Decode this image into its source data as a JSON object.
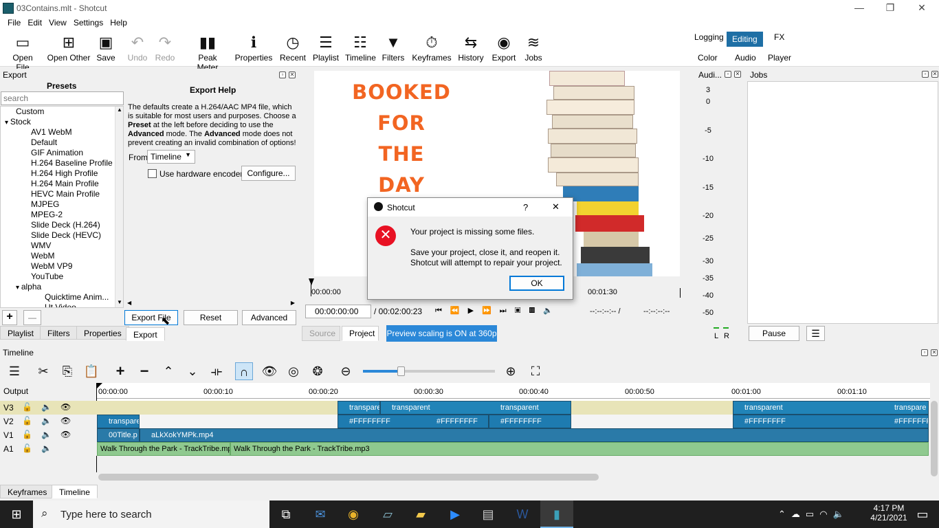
{
  "window": {
    "title": "03Contains.mlt - Shotcut",
    "minimize": "—",
    "restore": "❐",
    "close": "✕"
  },
  "menu": [
    "File",
    "Edit",
    "View",
    "Settings",
    "Help"
  ],
  "toolbar": {
    "open_file": "Open File",
    "open_other": "Open Other",
    "save": "Save",
    "undo": "Undo",
    "redo": "Redo",
    "peak_meter": "Peak Meter",
    "properties": "Properties",
    "recent": "Recent",
    "playlist": "Playlist",
    "timeline": "Timeline",
    "filters": "Filters",
    "keyframes": "Keyframes",
    "history": "History",
    "export": "Export",
    "jobs": "Jobs"
  },
  "workspaces": {
    "logging": "Logging",
    "editing": "Editing",
    "fx": "FX",
    "color": "Color",
    "audio": "Audio",
    "player": "Player"
  },
  "export_panel": {
    "title": "Export",
    "presets_title": "Presets",
    "search_placeholder": "search",
    "presets": [
      {
        "label": "Custom",
        "level": 1
      },
      {
        "label": "Stock",
        "level": 0,
        "expanded": true
      },
      {
        "label": "AV1 WebM",
        "level": 2
      },
      {
        "label": "Default",
        "level": 2
      },
      {
        "label": "GIF Animation",
        "level": 2
      },
      {
        "label": "H.264 Baseline Profile",
        "level": 2
      },
      {
        "label": "H.264 High Profile",
        "level": 2
      },
      {
        "label": "H.264 Main Profile",
        "level": 2
      },
      {
        "label": "HEVC Main Profile",
        "level": 2
      },
      {
        "label": "MJPEG",
        "level": 2
      },
      {
        "label": "MPEG-2",
        "level": 2
      },
      {
        "label": "Slide Deck (H.264)",
        "level": 2
      },
      {
        "label": "Slide Deck (HEVC)",
        "level": 2
      },
      {
        "label": "WMV",
        "level": 2
      },
      {
        "label": "WebM",
        "level": 2
      },
      {
        "label": "WebM VP9",
        "level": 2
      },
      {
        "label": "YouTube",
        "level": 2
      },
      {
        "label": "alpha",
        "level": 1,
        "expanded": true
      },
      {
        "label": "Quicktime Anim...",
        "level": 3
      },
      {
        "label": "Ut Video",
        "level": 3
      }
    ],
    "help_title": "Export Help",
    "help_p1": "The defaults create a H.264/AAC MP4 file, which is suitable for most users and purposes. Choose a ",
    "help_b1": "Preset",
    "help_p2": " at the left before deciding to use the ",
    "help_b2": "Advanced",
    "help_p3": " mode. The ",
    "help_b3": "Advanced",
    "help_p4": " mode does not prevent creating an invalid combination of options!",
    "from_label": "From",
    "from_value": "Timeline",
    "hw_encoder": "Use hardware encoder",
    "configure": "Configure...",
    "export_file": "Export File",
    "reset": "Reset",
    "advanced": "Advanced",
    "add": "+",
    "remove": "—"
  },
  "left_tabs": [
    "Playlist",
    "Filters",
    "Properties",
    "Export"
  ],
  "player": {
    "video_text": [
      "BOOKED",
      "FOR",
      "THE",
      "DAY"
    ],
    "ruler_start": "00:00:00",
    "ruler_mid": "00:01:30",
    "position": "00:00:00:00",
    "duration": "/ 00:02:00:23",
    "in_point": "--:--:--:-- /",
    "out_point": "--:--:--:--",
    "source_tab": "Source",
    "project_tab": "Project",
    "scaling_notice": "Preview scaling is ON at 360p"
  },
  "audio_meter": {
    "title": "Audi...",
    "ticks": [
      "3",
      "0",
      "-5",
      "-10",
      "-15",
      "-20",
      "-25",
      "-30",
      "-35",
      "-40",
      "-50"
    ],
    "left": "L",
    "right": "R"
  },
  "jobs": {
    "title": "Jobs",
    "pause": "Pause"
  },
  "timeline": {
    "title": "Timeline",
    "output_label": "Output",
    "ruler": [
      "00:00:00",
      "00:00:10",
      "00:00:20",
      "00:00:30",
      "00:00:40",
      "00:00:50",
      "00:01:00",
      "00:01:10"
    ],
    "tracks": [
      "V3",
      "V2",
      "V1",
      "A1"
    ],
    "v3_clips": [
      "transpare",
      "transparent",
      "transparent",
      "transparent",
      "transpare"
    ],
    "v2_clips": [
      "transpare",
      "#FFFFFFFF",
      "#FFFFFFFF",
      "#FFFFFFFF",
      "#FFFFFFFF",
      "#FFFFFFF"
    ],
    "v1_clips": [
      "00Title.p",
      "aLkXokYMPk.mp4"
    ],
    "a1_clips": [
      "Walk Through the Park - TrackTribe.mp3",
      "Walk Through the Park - TrackTribe.mp3"
    ]
  },
  "bottom_tabs": [
    "Keyframes",
    "Timeline"
  ],
  "dialog": {
    "title": "Shotcut",
    "help": "?",
    "close": "✕",
    "line1": "Your project is missing some files.",
    "line2": "Save your project, close it, and reopen it.",
    "line3": "Shotcut will attempt to repair your project.",
    "ok": "OK"
  },
  "taskbar": {
    "search_placeholder": "Type here to search",
    "time": "4:17 PM",
    "date": "4/21/2021"
  }
}
